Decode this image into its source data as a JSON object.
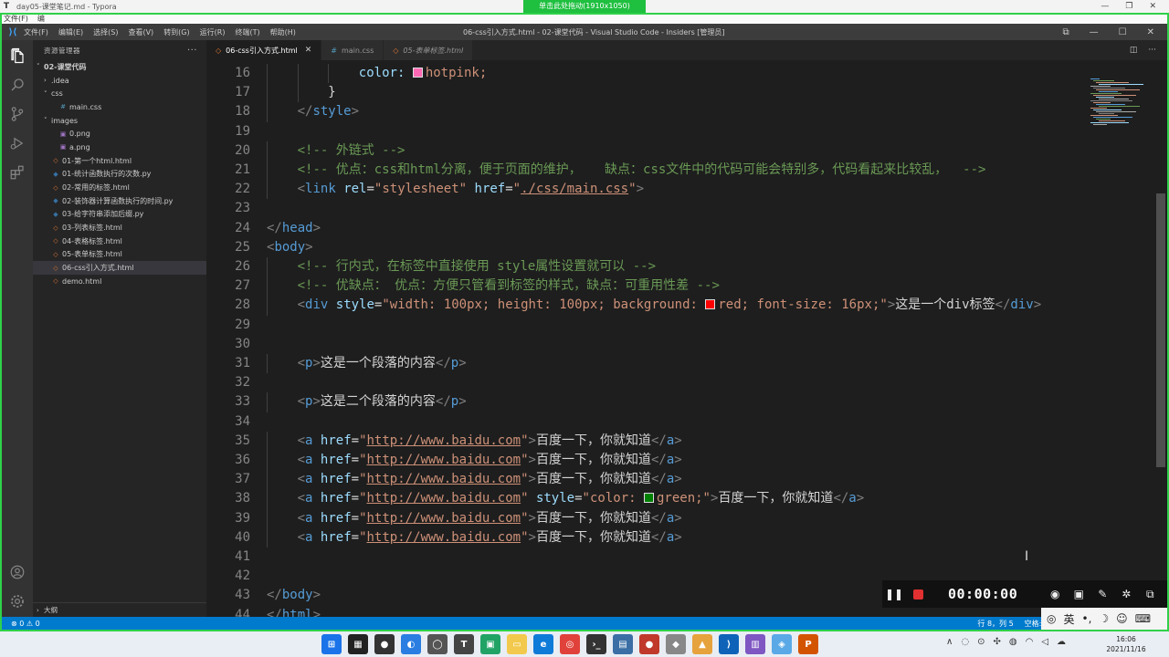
{
  "typora": {
    "title": "day05-课堂笔记.md - Typora",
    "menu": [
      "文件(F)",
      "编"
    ]
  },
  "recording_banner": "单击此处拖动(1910x1050)",
  "window": {
    "menu": [
      "文件(F)",
      "编辑(E)",
      "选择(S)",
      "查看(V)",
      "转到(G)",
      "运行(R)",
      "终端(T)",
      "帮助(H)"
    ],
    "title": "06-css引入方式.html - 02-课堂代码 - Visual Studio Code - Insiders [管理员]"
  },
  "sidebar": {
    "header": "资源管理器",
    "more": "···",
    "tree": [
      {
        "label": "02-课堂代码",
        "depth": 0,
        "twisty": "˅",
        "icon": "",
        "bold": true
      },
      {
        "label": ".idea",
        "depth": 1,
        "twisty": "›",
        "icon": ""
      },
      {
        "label": "css",
        "depth": 1,
        "twisty": "˅",
        "icon": ""
      },
      {
        "label": "main.css",
        "depth": 2,
        "twisty": "",
        "icon": "#",
        "icon_color": "#519aba"
      },
      {
        "label": "images",
        "depth": 1,
        "twisty": "˅",
        "icon": ""
      },
      {
        "label": "0.png",
        "depth": 2,
        "twisty": "",
        "icon": "▣",
        "icon_color": "#a074c4"
      },
      {
        "label": "a.png",
        "depth": 2,
        "twisty": "",
        "icon": "▣",
        "icon_color": "#a074c4"
      },
      {
        "label": "01-第一个html.html",
        "depth": 1,
        "twisty": "",
        "icon": "◇",
        "icon_color": "#e37933"
      },
      {
        "label": "01-统计函数执行的次数.py",
        "depth": 1,
        "twisty": "",
        "icon": "◆",
        "icon_color": "#3572a5"
      },
      {
        "label": "02-常用的标签.html",
        "depth": 1,
        "twisty": "",
        "icon": "◇",
        "icon_color": "#e37933"
      },
      {
        "label": "02-装饰器计算函数执行的时间.py",
        "depth": 1,
        "twisty": "",
        "icon": "◆",
        "icon_color": "#3572a5"
      },
      {
        "label": "03-给字符串添加后缀.py",
        "depth": 1,
        "twisty": "",
        "icon": "◆",
        "icon_color": "#3572a5"
      },
      {
        "label": "03-列表标签.html",
        "depth": 1,
        "twisty": "",
        "icon": "◇",
        "icon_color": "#e37933"
      },
      {
        "label": "04-表格标签.html",
        "depth": 1,
        "twisty": "",
        "icon": "◇",
        "icon_color": "#e37933"
      },
      {
        "label": "05-表单标签.html",
        "depth": 1,
        "twisty": "",
        "icon": "◇",
        "icon_color": "#e37933"
      },
      {
        "label": "06-css引入方式.html",
        "depth": 1,
        "twisty": "",
        "icon": "◇",
        "icon_color": "#e37933",
        "active": true
      },
      {
        "label": "demo.html",
        "depth": 1,
        "twisty": "",
        "icon": "◇",
        "icon_color": "#e37933"
      }
    ],
    "outline": "大纲"
  },
  "tabs": [
    {
      "label": "06-css引入方式.html",
      "icon": "◇",
      "kind": "html",
      "active": true,
      "close": "✕"
    },
    {
      "label": "main.css",
      "icon": "#",
      "kind": "css",
      "active": false
    },
    {
      "label": "05-表单标签.html",
      "icon": "◇",
      "kind": "html",
      "active": false,
      "italic": true
    }
  ],
  "breadcrumb": [
    "06-css引入方式.html",
    "html",
    "head"
  ],
  "editor": {
    "lines": [
      {
        "n": "16",
        "indent": 3,
        "segs": [
          [
            "attr",
            "color: "
          ],
          [
            "swatch",
            "#ff69b4"
          ],
          [
            "str",
            "hotpink;"
          ]
        ]
      },
      {
        "n": "17",
        "indent": 2,
        "segs": [
          [
            "txt",
            "}"
          ]
        ]
      },
      {
        "n": "18",
        "indent": 1,
        "segs": [
          [
            "br",
            "</"
          ],
          [
            "tag",
            "style"
          ],
          [
            "br",
            ">"
          ]
        ]
      },
      {
        "n": "19",
        "indent": 0,
        "segs": []
      },
      {
        "n": "20",
        "indent": 1,
        "segs": [
          [
            "com",
            "<!-- 外链式 -->"
          ]
        ]
      },
      {
        "n": "21",
        "indent": 1,
        "segs": [
          [
            "com",
            "<!-- 优点：css和html分离，便于页面的维护，   缺点：css文件中的代码可能会特别多，代码看起来比较乱，  -->"
          ]
        ]
      },
      {
        "n": "22",
        "indent": 1,
        "segs": [
          [
            "br",
            "<"
          ],
          [
            "tag",
            "link"
          ],
          [
            "txt",
            " "
          ],
          [
            "attr",
            "rel"
          ],
          [
            "txt",
            "="
          ],
          [
            "str",
            "\"stylesheet\""
          ],
          [
            "txt",
            " "
          ],
          [
            "attr",
            "href"
          ],
          [
            "txt",
            "="
          ],
          [
            "str",
            "\""
          ],
          [
            "url",
            "./css/main.css"
          ],
          [
            "str",
            "\""
          ],
          [
            "br",
            ">"
          ]
        ]
      },
      {
        "n": "23",
        "indent": 0,
        "segs": []
      },
      {
        "n": "24",
        "indent": 0,
        "segs": [
          [
            "br",
            "</"
          ],
          [
            "tag",
            "head"
          ],
          [
            "br",
            ">"
          ]
        ]
      },
      {
        "n": "25",
        "indent": 0,
        "segs": [
          [
            "br",
            "<"
          ],
          [
            "tag",
            "body"
          ],
          [
            "br",
            ">"
          ]
        ]
      },
      {
        "n": "26",
        "indent": 1,
        "segs": [
          [
            "com",
            "<!-- 行内式，在标签中直接使用 style属性设置就可以 -->"
          ]
        ]
      },
      {
        "n": "27",
        "indent": 1,
        "segs": [
          [
            "com",
            "<!-- 优缺点： 优点：方便只管看到标签的样式，缺点：可重用性差 -->"
          ]
        ]
      },
      {
        "n": "28",
        "indent": 1,
        "segs": [
          [
            "br",
            "<"
          ],
          [
            "tag",
            "div"
          ],
          [
            "txt",
            " "
          ],
          [
            "attr",
            "style"
          ],
          [
            "txt",
            "="
          ],
          [
            "str",
            "\"width: 100px; height: 100px; background: "
          ],
          [
            "swatch",
            "#ff0000"
          ],
          [
            "str",
            "red; font-size: 16px;\""
          ],
          [
            "br",
            ">"
          ],
          [
            "txt",
            "这是一个div标签"
          ],
          [
            "br",
            "</"
          ],
          [
            "tag",
            "div"
          ],
          [
            "br",
            ">"
          ]
        ]
      },
      {
        "n": "29",
        "indent": 0,
        "segs": []
      },
      {
        "n": "30",
        "indent": 0,
        "segs": []
      },
      {
        "n": "31",
        "indent": 1,
        "segs": [
          [
            "br",
            "<"
          ],
          [
            "tag",
            "p"
          ],
          [
            "br",
            ">"
          ],
          [
            "txt",
            "这是一个段落的内容"
          ],
          [
            "br",
            "</"
          ],
          [
            "tag",
            "p"
          ],
          [
            "br",
            ">"
          ]
        ]
      },
      {
        "n": "32",
        "indent": 0,
        "segs": []
      },
      {
        "n": "33",
        "indent": 1,
        "segs": [
          [
            "br",
            "<"
          ],
          [
            "tag",
            "p"
          ],
          [
            "br",
            ">"
          ],
          [
            "txt",
            "这是二个段落的内容"
          ],
          [
            "br",
            "</"
          ],
          [
            "tag",
            "p"
          ],
          [
            "br",
            ">"
          ]
        ]
      },
      {
        "n": "34",
        "indent": 0,
        "segs": []
      },
      {
        "n": "35",
        "indent": 1,
        "segs": [
          [
            "br",
            "<"
          ],
          [
            "tag",
            "a"
          ],
          [
            "txt",
            " "
          ],
          [
            "attr",
            "href"
          ],
          [
            "txt",
            "="
          ],
          [
            "str",
            "\""
          ],
          [
            "url",
            "http://www.baidu.com"
          ],
          [
            "str",
            "\""
          ],
          [
            "br",
            ">"
          ],
          [
            "txt",
            "百度一下，你就知道"
          ],
          [
            "br",
            "</"
          ],
          [
            "tag",
            "a"
          ],
          [
            "br",
            ">"
          ]
        ]
      },
      {
        "n": "36",
        "indent": 1,
        "segs": [
          [
            "br",
            "<"
          ],
          [
            "tag",
            "a"
          ],
          [
            "txt",
            " "
          ],
          [
            "attr",
            "href"
          ],
          [
            "txt",
            "="
          ],
          [
            "str",
            "\""
          ],
          [
            "url",
            "http://www.baidu.com"
          ],
          [
            "str",
            "\""
          ],
          [
            "br",
            ">"
          ],
          [
            "txt",
            "百度一下，你就知道"
          ],
          [
            "br",
            "</"
          ],
          [
            "tag",
            "a"
          ],
          [
            "br",
            ">"
          ]
        ]
      },
      {
        "n": "37",
        "indent": 1,
        "segs": [
          [
            "br",
            "<"
          ],
          [
            "tag",
            "a"
          ],
          [
            "txt",
            " "
          ],
          [
            "attr",
            "href"
          ],
          [
            "txt",
            "="
          ],
          [
            "str",
            "\""
          ],
          [
            "url",
            "http://www.baidu.com"
          ],
          [
            "str",
            "\""
          ],
          [
            "br",
            ">"
          ],
          [
            "txt",
            "百度一下，你就知道"
          ],
          [
            "br",
            "</"
          ],
          [
            "tag",
            "a"
          ],
          [
            "br",
            ">"
          ]
        ]
      },
      {
        "n": "38",
        "indent": 1,
        "segs": [
          [
            "br",
            "<"
          ],
          [
            "tag",
            "a"
          ],
          [
            "txt",
            " "
          ],
          [
            "attr",
            "href"
          ],
          [
            "txt",
            "="
          ],
          [
            "str",
            "\""
          ],
          [
            "url",
            "http://www.baidu.com"
          ],
          [
            "str",
            "\""
          ],
          [
            "txt",
            " "
          ],
          [
            "attr",
            "style"
          ],
          [
            "txt",
            "="
          ],
          [
            "str",
            "\"color: "
          ],
          [
            "swatch",
            "#008000"
          ],
          [
            "str",
            "green;\""
          ],
          [
            "br",
            ">"
          ],
          [
            "txt",
            "百度一下，你就知道"
          ],
          [
            "br",
            "</"
          ],
          [
            "tag",
            "a"
          ],
          [
            "br",
            ">"
          ]
        ]
      },
      {
        "n": "39",
        "indent": 1,
        "segs": [
          [
            "br",
            "<"
          ],
          [
            "tag",
            "a"
          ],
          [
            "txt",
            " "
          ],
          [
            "attr",
            "href"
          ],
          [
            "txt",
            "="
          ],
          [
            "str",
            "\""
          ],
          [
            "url",
            "http://www.baidu.com"
          ],
          [
            "str",
            "\""
          ],
          [
            "br",
            ">"
          ],
          [
            "txt",
            "百度一下，你就知道"
          ],
          [
            "br",
            "</"
          ],
          [
            "tag",
            "a"
          ],
          [
            "br",
            ">"
          ]
        ]
      },
      {
        "n": "40",
        "indent": 1,
        "segs": [
          [
            "br",
            "<"
          ],
          [
            "tag",
            "a"
          ],
          [
            "txt",
            " "
          ],
          [
            "attr",
            "href"
          ],
          [
            "txt",
            "="
          ],
          [
            "str",
            "\""
          ],
          [
            "url",
            "http://www.baidu.com"
          ],
          [
            "str",
            "\""
          ],
          [
            "br",
            ">"
          ],
          [
            "txt",
            "百度一下，你就知道"
          ],
          [
            "br",
            "</"
          ],
          [
            "tag",
            "a"
          ],
          [
            "br",
            ">"
          ]
        ]
      },
      {
        "n": "41",
        "indent": 0,
        "segs": []
      },
      {
        "n": "42",
        "indent": 0,
        "segs": []
      },
      {
        "n": "43",
        "indent": 0,
        "segs": [
          [
            "br",
            "</"
          ],
          [
            "tag",
            "body"
          ],
          [
            "br",
            ">"
          ]
        ]
      },
      {
        "n": "44",
        "indent": 0,
        "segs": [
          [
            "br",
            "</"
          ],
          [
            "tag",
            "html"
          ],
          [
            "br",
            ">"
          ]
        ]
      }
    ]
  },
  "statusbar": {
    "left": "⊗ 0 ⚠ 0",
    "position": "行 8，列 5",
    "spaces": "空格: 4"
  },
  "recorder": {
    "time": "00:00:00"
  },
  "ime": {
    "lang": "英"
  },
  "taskbar": {
    "time": "16:06",
    "date": "2021/11/16"
  },
  "colors": {
    "accent": "#007acc",
    "record_frame": "#2fd14a"
  }
}
